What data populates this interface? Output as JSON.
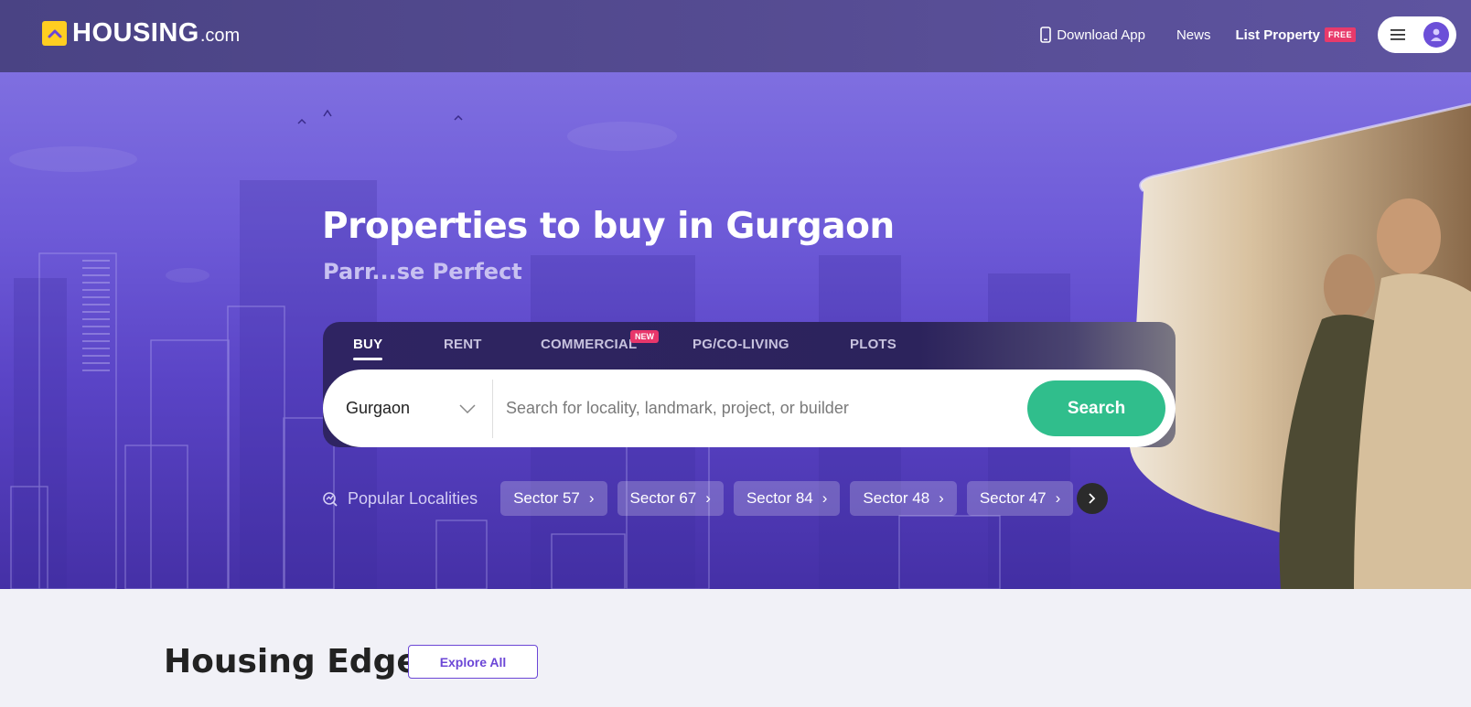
{
  "header": {
    "logo_text": "HOUSING",
    "logo_suffix": ".com",
    "download_app": "Download App",
    "news": "News",
    "list_property": "List Property",
    "free_badge": "FREE"
  },
  "hero": {
    "title": "Properties to buy in Gurgaon",
    "subtitle": "Parr...se Perfect",
    "tabs": [
      {
        "label": "BUY",
        "active": true
      },
      {
        "label": "RENT",
        "active": false
      },
      {
        "label": "COMMERCIAL",
        "active": false
      },
      {
        "label": "PG/CO-LIVING",
        "active": false
      },
      {
        "label": "PLOTS",
        "active": false
      }
    ],
    "new_badge": "NEW",
    "city": "Gurgaon",
    "search_placeholder": "Search for locality, landmark, project, or builder",
    "search_button": "Search",
    "popular_label": "Popular Localities",
    "localities": [
      "Sector 57",
      "Sector 67",
      "Sector 84",
      "Sector 48",
      "Sector 47"
    ]
  },
  "edge": {
    "title_regular": "Housing",
    "title_bold": "Edge",
    "explore_button": "Explore All"
  },
  "colors": {
    "brand_yellow": "#ffce21",
    "search_green": "#30be8c",
    "accent_purple": "#6b46d6",
    "badge_pink": "#e8366b"
  }
}
